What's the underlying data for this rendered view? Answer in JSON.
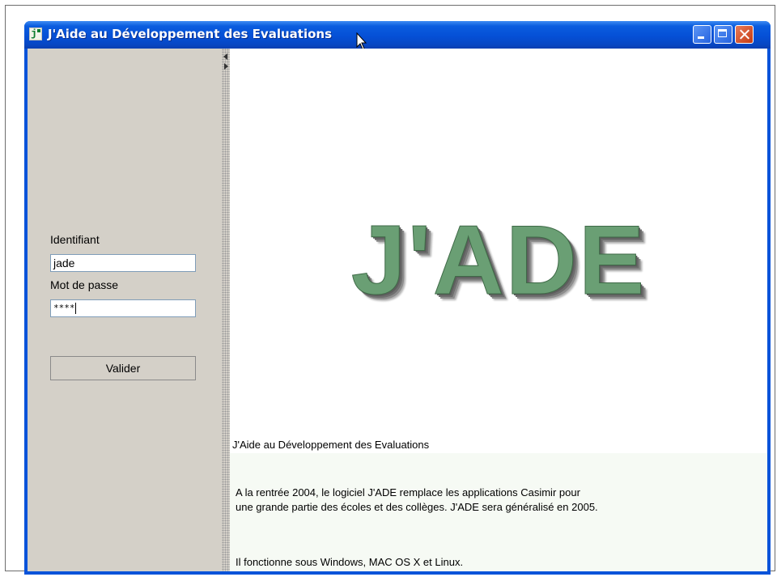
{
  "window": {
    "title": "J'Aide au Développement des Evaluations",
    "app_icon": "java-app-icon",
    "controls": [
      "minimize",
      "maximize",
      "close"
    ]
  },
  "login": {
    "id_label": "Identifiant",
    "id_value": "jade",
    "password_label": "Mot de passe",
    "password_value": "****",
    "submit_label": "Valider"
  },
  "content": {
    "logo": "J'ADE",
    "tagline": "J'Aide au Développement des Evaluations",
    "para1_line1": "A la rentrée 2004, le logiciel J'ADE remplace les applications Casimir pour",
    "para1_line2": "une grande partie des écoles et des collèges. J'ADE sera généralisé en 2005.",
    "para2": "Il fonctionne sous Windows, MAC OS X et Linux."
  },
  "colors": {
    "titlebar": "#0550d6",
    "logo_green": "#6a9f74",
    "panel_gray": "#d4d0c8"
  }
}
